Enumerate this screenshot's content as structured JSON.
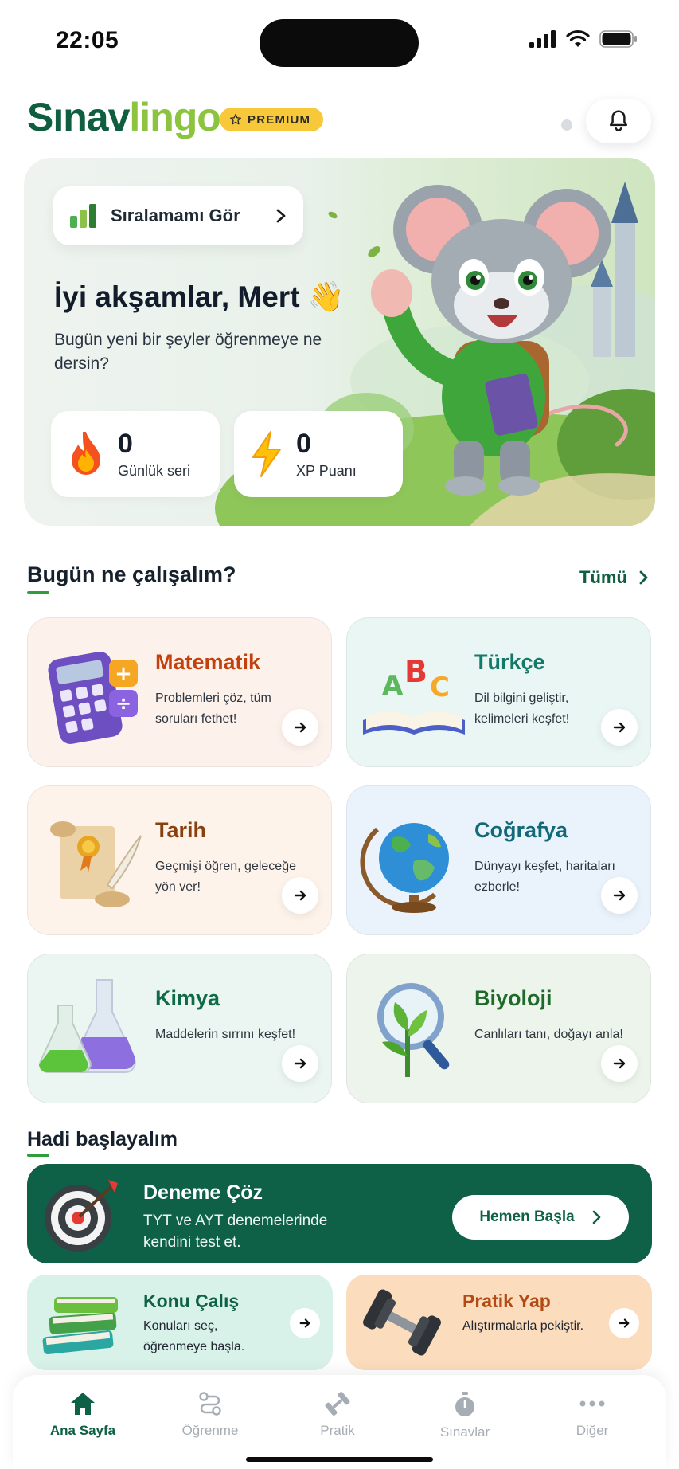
{
  "status_bar": {
    "time": "22:05"
  },
  "header": {
    "logo_part1": "Sınav",
    "logo_part2": "lingo",
    "premium_label": "PREMIUM",
    "notification_icon": "bell-icon"
  },
  "hero": {
    "ranking_label": "Sıralamamı Gör",
    "greeting": "İyi akşamlar, Mert 👋",
    "subtitle": "Bugün yeni bir şeyler öğrenmeye ne dersin?",
    "streak": {
      "value": "0",
      "label": "Günlük seri",
      "icon": "flame-icon"
    },
    "xp": {
      "value": "0",
      "label": "XP Puanı",
      "icon": "lightning-icon"
    }
  },
  "subjects_section": {
    "title": "Bugün ne çalışalım?",
    "see_all": "Tümü",
    "subjects": [
      {
        "title": "Matematik",
        "desc": "Problemleri çöz, tüm soruları fethet!",
        "icon": "calculator-icon",
        "color": "#c2410c",
        "bg": "#fdf1ec"
      },
      {
        "title": "Türkçe",
        "desc": "Dil bilgini geliştir, kelimeleri keşfet!",
        "icon": "abc-book-icon",
        "color": "#137a6a",
        "bg": "#eaf6f4"
      },
      {
        "title": "Tarih",
        "desc": "Geçmişi öğren, geleceğe yön ver!",
        "icon": "scroll-icon",
        "color": "#8a3f0f",
        "bg": "#fdf3ea"
      },
      {
        "title": "Coğrafya",
        "desc": "Dünyayı keşfet, haritaları ezberle!",
        "icon": "globe-icon",
        "color": "#126a79",
        "bg": "#eaf3fb"
      },
      {
        "title": "Kimya",
        "desc": "Maddelerin sırrını keşfet!",
        "icon": "flask-icon",
        "color": "#0f6a49",
        "bg": "#ebf5f1"
      },
      {
        "title": "Biyoloji",
        "desc": "Canlıları tanı, doğayı anla!",
        "icon": "plant-magnifier-icon",
        "color": "#1f6a2a",
        "bg": "#ecf4ec"
      }
    ]
  },
  "start_section": {
    "title": "Hadi başlayalım",
    "exam": {
      "title": "Deneme Çöz",
      "desc": "TYT ve AYT denemelerinde kendini test et.",
      "button": "Hemen Başla",
      "icon": "target-icon"
    },
    "study": {
      "title": "Konu Çalış",
      "desc": "Konuları seç, öğrenmeye başla.",
      "icon": "books-icon",
      "color": "#0e6146",
      "bg": "#d8f1e9"
    },
    "practice": {
      "title": "Pratik Yap",
      "desc": "Alıştırmalarla pekiştir.",
      "icon": "dumbbell-icon",
      "color": "#b34a13",
      "bg": "#fbdcbc"
    }
  },
  "tabbar": {
    "tabs": [
      {
        "label": "Ana Sayfa",
        "icon": "home-icon",
        "active": true
      },
      {
        "label": "Öğrenme",
        "icon": "route-icon",
        "active": false
      },
      {
        "label": "Pratik",
        "icon": "dumbbell-icon",
        "active": false
      },
      {
        "label": "Sınavlar",
        "icon": "stopwatch-icon",
        "active": false
      },
      {
        "label": "Diğer",
        "icon": "more-icon",
        "active": false
      }
    ]
  },
  "colors": {
    "brand": "#0e6146",
    "accent": "#8cc43f",
    "premium": "#f7c93a"
  }
}
